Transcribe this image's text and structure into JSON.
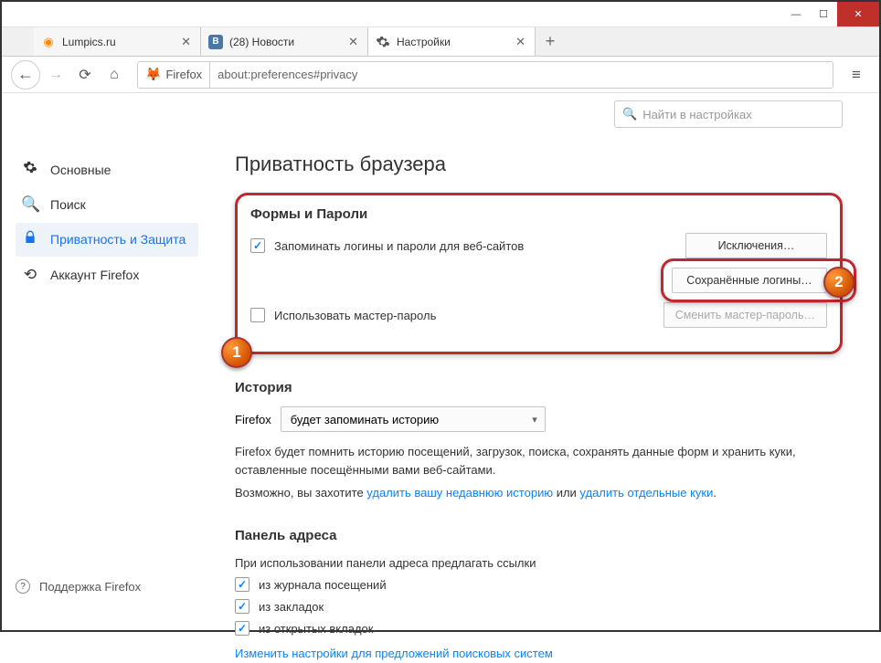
{
  "window": {
    "min": "—",
    "max": "☐",
    "close": "✕"
  },
  "tabs": [
    {
      "label": "Lumpics.ru",
      "icon_color": "#ff8a00"
    },
    {
      "label": "(28) Новости",
      "icon_color": "#4a76a8"
    },
    {
      "label": "Настройки",
      "icon_color": "#555"
    }
  ],
  "nav": {
    "identity": "Firefox",
    "url": "about:preferences#privacy"
  },
  "sidebar": {
    "items": [
      {
        "label": "Основные"
      },
      {
        "label": "Поиск"
      },
      {
        "label": "Приватность и Защита"
      },
      {
        "label": "Аккаунт Firefox"
      }
    ],
    "support": "Поддержка Firefox"
  },
  "search_placeholder": "Найти в настройках",
  "page_title": "Приватность браузера",
  "forms": {
    "heading": "Формы и Пароли",
    "remember": "Запоминать логины и пароли для веб-сайтов",
    "exceptions": "Исключения…",
    "saved_logins": "Сохранённые логины…",
    "master": "Использовать мастер-пароль",
    "change_master": "Сменить мастер-пароль…"
  },
  "history": {
    "heading": "История",
    "firefox_label": "Firefox",
    "mode": "будет запоминать историю",
    "desc": "Firefox будет помнить историю посещений, загрузок, поиска, сохранять данные форм и хранить куки, оставленные посещёнными вами веб-сайтами.",
    "maybe": "Возможно, вы захотите ",
    "link_recent": "удалить вашу недавнюю историю",
    "or": " или ",
    "link_cookies": "удалить отдельные куки",
    "dot": "."
  },
  "addressbar": {
    "heading": "Панель адреса",
    "desc": "При использовании панели адреса предлагать ссылки",
    "opt_history": "из журнала посещений",
    "opt_bookmarks": "из закладок",
    "opt_opentabs": "из открытых вкладок",
    "change_link": "Изменить настройки для предложений поисковых систем"
  },
  "badges": {
    "one": "1",
    "two": "2"
  }
}
